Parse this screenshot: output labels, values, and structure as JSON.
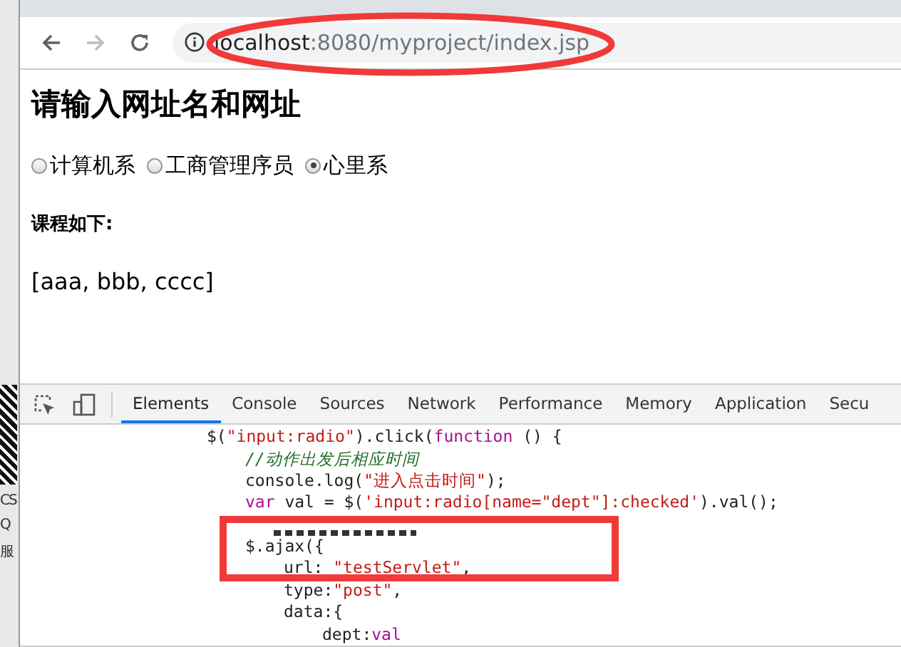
{
  "desktop_strip": {
    "texts": [
      "CS",
      "Q",
      "服"
    ]
  },
  "address_bar": {
    "host": "localhost",
    "path": ":8080/myproject/index.jsp"
  },
  "page": {
    "heading": "请输入网址名和网址",
    "radios": [
      {
        "label": "计算机系",
        "selected": false
      },
      {
        "label": "工商管理序员",
        "selected": false
      },
      {
        "label": "心里系",
        "selected": true
      }
    ],
    "courses_label": "课程如下:",
    "courses": "[aaa, bbb, cccc]"
  },
  "devtools": {
    "tabs": [
      {
        "label": "Elements",
        "selected": true
      },
      {
        "label": "Console",
        "selected": false
      },
      {
        "label": "Sources",
        "selected": false
      },
      {
        "label": "Network",
        "selected": false
      },
      {
        "label": "Performance",
        "selected": false
      },
      {
        "label": "Memory",
        "selected": false
      },
      {
        "label": "Application",
        "selected": false
      },
      {
        "label": "Secu",
        "selected": false
      }
    ],
    "code": [
      {
        "tokens": [
          {
            "kind": "plain",
            "text": "$("
          },
          {
            "kind": "string",
            "text": "\"input:radio\""
          },
          {
            "kind": "plain",
            "text": ").click("
          },
          {
            "kind": "keyword",
            "text": "function"
          },
          {
            "kind": "plain",
            "text": " () {"
          }
        ],
        "children": [
          {
            "tokens": [
              {
                "kind": "comment",
                "text": "//动作出发后相应时间"
              }
            ]
          },
          {
            "tokens": [
              {
                "kind": "plain",
                "text": "console.log("
              },
              {
                "kind": "string",
                "text": "\"进入点击时间\""
              },
              {
                "kind": "plain",
                "text": ");"
              }
            ]
          },
          {
            "tokens": [
              {
                "kind": "keyword",
                "text": "var"
              },
              {
                "kind": "plain",
                "text": " val = $("
              },
              {
                "kind": "string",
                "text": "'input:radio[name=\"dept\"]:checked'"
              },
              {
                "kind": "plain",
                "text": ").val();"
              }
            ]
          },
          {
            "hidden": true
          },
          {
            "tokens": [
              {
                "kind": "plain",
                "text": "$.ajax({"
              }
            ],
            "children": [
              {
                "tokens": [
                  {
                    "kind": "plain",
                    "text": "url: "
                  },
                  {
                    "kind": "string",
                    "text": "\"testServlet\""
                  },
                  {
                    "kind": "plain",
                    "text": ","
                  }
                ]
              },
              {
                "tokens": [
                  {
                    "kind": "plain",
                    "text": "type:"
                  },
                  {
                    "kind": "string",
                    "text": "\"post\""
                  },
                  {
                    "kind": "plain",
                    "text": ","
                  }
                ]
              },
              {
                "tokens": [
                  {
                    "kind": "plain",
                    "text": "data:{"
                  }
                ],
                "children": [
                  {
                    "tokens": [
                      {
                        "kind": "plain",
                        "text": "dept:"
                      },
                      {
                        "kind": "keyword",
                        "text": "val"
                      }
                    ]
                  }
                ]
              }
            ]
          }
        ]
      }
    ]
  }
}
